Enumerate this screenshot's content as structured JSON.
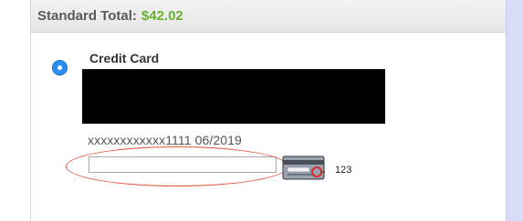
{
  "header": {
    "total_label": "Standard Total:",
    "total_amount": "$42.02"
  },
  "payment": {
    "method_label": "Credit Card",
    "selected": true,
    "card_number": "xxxxxxxxxxxx1111 06/2019",
    "cvv_input": {
      "value": "",
      "placeholder": ""
    },
    "cvv_hint": "123",
    "card_icon": "credit-card-cvv-icon"
  },
  "colors": {
    "accent_green": "#65b32e",
    "radio_blue": "#2f8ef4",
    "annotation_red": "#e2533c"
  }
}
